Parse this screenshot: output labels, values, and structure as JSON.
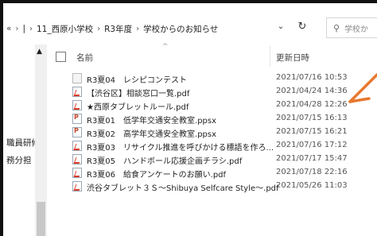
{
  "breadcrumb": {
    "lead": "«",
    "items": [
      "|",
      "11_西原小学校",
      "R3年度",
      "学校からのお知らせ"
    ]
  },
  "toolbar": {
    "dropdown_icon": "chevron-down-icon",
    "refresh_icon": "refresh-icon"
  },
  "search": {
    "placeholder": "学校か"
  },
  "nav": {
    "items": [
      "職員研修",
      "務分担"
    ]
  },
  "columns": {
    "name": "名前",
    "date": "更新日時"
  },
  "files": [
    {
      "name": "R3夏04　レシピコンテスト",
      "date": "2021/07/16 10:53",
      "icon": "blank-file-icon"
    },
    {
      "name": "【渋谷区】相談窓口一覧.pdf",
      "date": "2021/04/24 14:36",
      "icon": "pdf-icon"
    },
    {
      "name": "★西原タブレットルール.pdf",
      "date": "2021/04/28 12:26",
      "icon": "pdf-icon"
    },
    {
      "name": "R3夏01　低学年交通安全教室.ppsx",
      "date": "2021/07/15 16:13",
      "icon": "pptx-icon"
    },
    {
      "name": "R3夏02　高学年交通安全教室.ppsx",
      "date": "2021/07/15 16:21",
      "icon": "pptx-icon"
    },
    {
      "name": "R3夏03　リサイクル推進を呼びかける標語を作ろ...",
      "date": "2021/07/16 17:12",
      "icon": "pdf-icon"
    },
    {
      "name": "R3夏05　ハンドボール応援企画チラシ.pdf",
      "date": "2021/07/17 15:47",
      "icon": "pdf-icon"
    },
    {
      "name": "R3夏06　給食アンケートのお願い.pdf",
      "date": "2021/07/18 22:16",
      "icon": "pdf-icon"
    },
    {
      "name": "渋谷タブレット３Ｓ～Shibuya Selfcare Style～.pdf",
      "date": "2021/05/26 11:03",
      "icon": "pdf-icon"
    }
  ],
  "colors": {
    "arrow": "#e8772e",
    "frame": "#111111",
    "scroll_thumb": "#c8c8c8"
  }
}
